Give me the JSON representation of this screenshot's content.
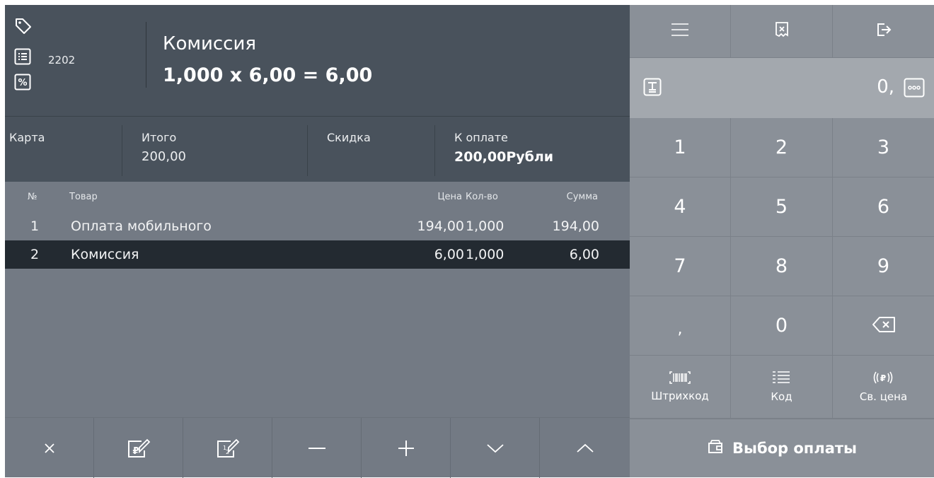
{
  "header": {
    "item_code": "2202",
    "item_name": "Комиссия",
    "item_calc": "1,000 x 6,00 = 6,00",
    "icons": [
      "tag-icon",
      "list-icon",
      "percent-icon"
    ]
  },
  "summary": {
    "payment_type": "Карта",
    "total_label": "Итого",
    "total_value": "200,00",
    "discount_label": "Скидка",
    "discount_value": "",
    "due_label": "К оплате",
    "due_value": "200,00Рубли"
  },
  "table": {
    "headers": {
      "num": "№",
      "name": "Товар",
      "price": "Цена",
      "qty": "Кол-во",
      "sum": "Сумма"
    },
    "rows": [
      {
        "num": "1",
        "name": "Оплата мобильного",
        "price": "194,00",
        "qty": "1,000",
        "sum": "194,00",
        "selected": false
      },
      {
        "num": "2",
        "name": "Комиссия",
        "price": "6,00",
        "qty": "1,000",
        "sum": "6,00",
        "selected": true
      }
    ]
  },
  "toolbar": {
    "buttons": [
      "delete-icon",
      "edit-price-icon",
      "edit-quantity-icon",
      "minus-icon",
      "plus-icon",
      "chevron-down-icon",
      "chevron-up-icon"
    ]
  },
  "keypad": {
    "top_icons": [
      "menu-icon",
      "cancel-receipt-icon",
      "logout-icon"
    ],
    "display_value": "0,",
    "keys": [
      "1",
      "2",
      "3",
      "4",
      "5",
      "6",
      "7",
      "8",
      "9",
      ",",
      "0"
    ],
    "barcode_label": "Штрихкод",
    "code_label": "Код",
    "free_price_label": "Св. цена",
    "pay_label": "Выбор оплаты"
  },
  "colors": {
    "header_bg": "#49525c",
    "list_bg": "#737a84",
    "selected_row": "#232a31",
    "keypad_bg": "#8a9098",
    "display_bg": "#a3a8ae"
  }
}
